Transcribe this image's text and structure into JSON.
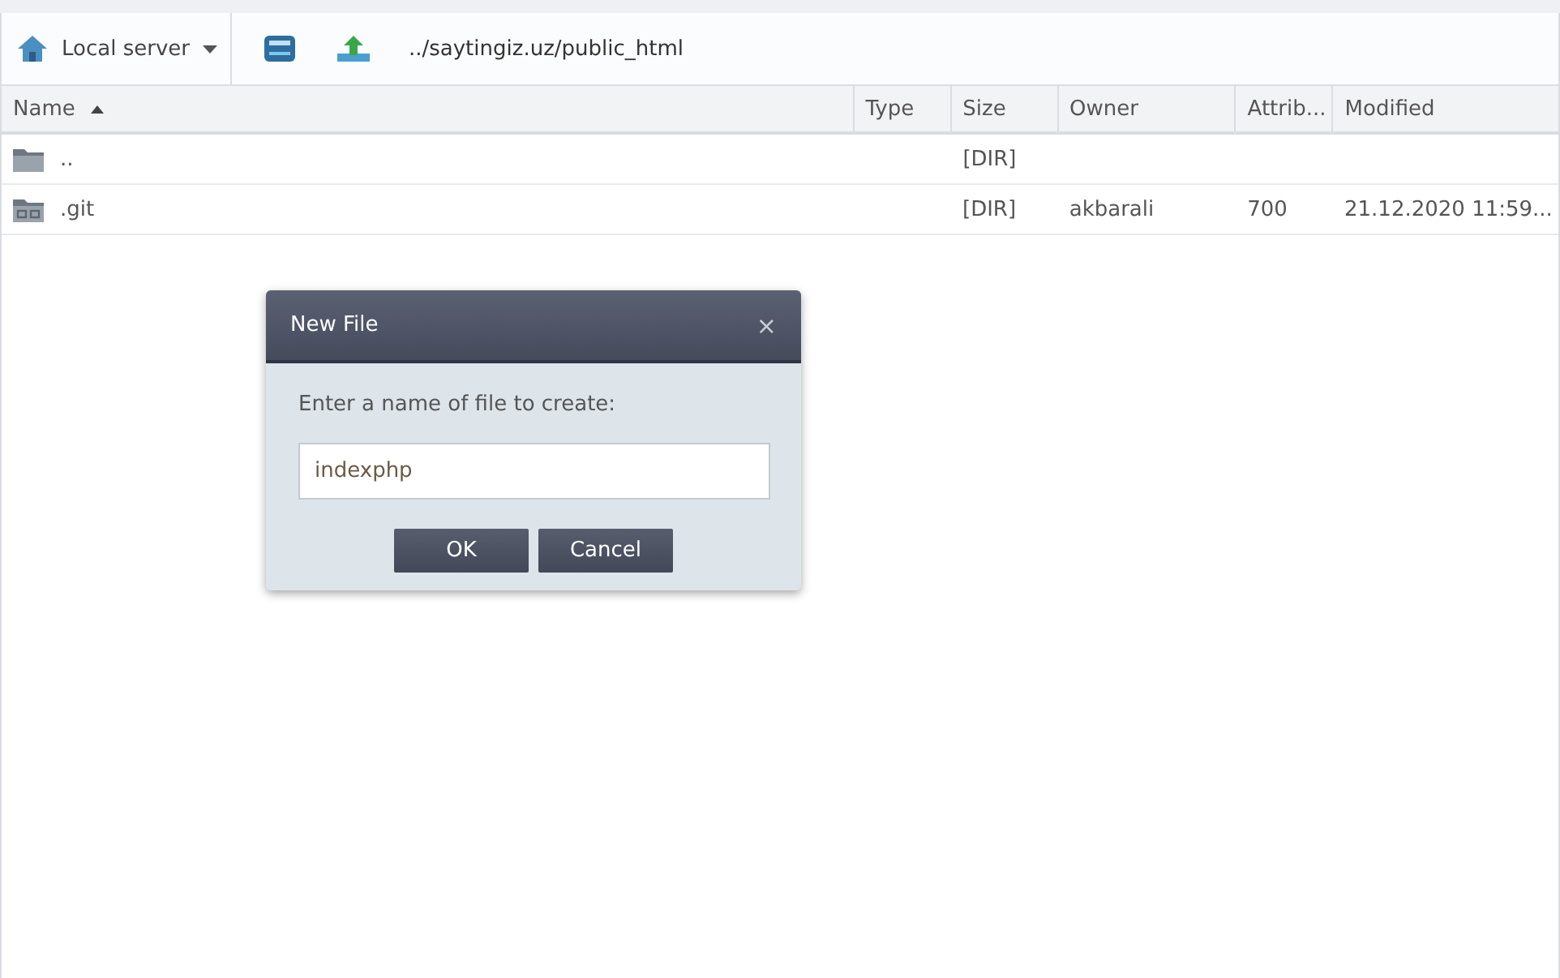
{
  "toolbar": {
    "server": "Local server",
    "path": "../saytingiz.uz/public_html"
  },
  "table": {
    "columns": [
      {
        "label": "Name",
        "sorted": true
      },
      {
        "label": "Type",
        "sorted": false
      },
      {
        "label": "Size",
        "sorted": false
      },
      {
        "label": "Owner",
        "sorted": false
      },
      {
        "label": "Attrib...",
        "sorted": false
      },
      {
        "label": "Modified",
        "sorted": false
      }
    ],
    "rows": [
      {
        "kind": "parent",
        "name": "..",
        "type": "",
        "size": "[DIR]",
        "owner": "",
        "attrib": "",
        "modified": ""
      },
      {
        "kind": "repo",
        "name": ".git",
        "type": "",
        "size": "[DIR]",
        "owner": "akbarali",
        "attrib": "700",
        "modified": "21.12.2020 11:59..."
      }
    ]
  },
  "dialog": {
    "title": "New File",
    "close": "×",
    "prompt": "Enter a name of file to create:",
    "value": "indexphp",
    "buttons": [
      "OK",
      "Cancel"
    ]
  }
}
